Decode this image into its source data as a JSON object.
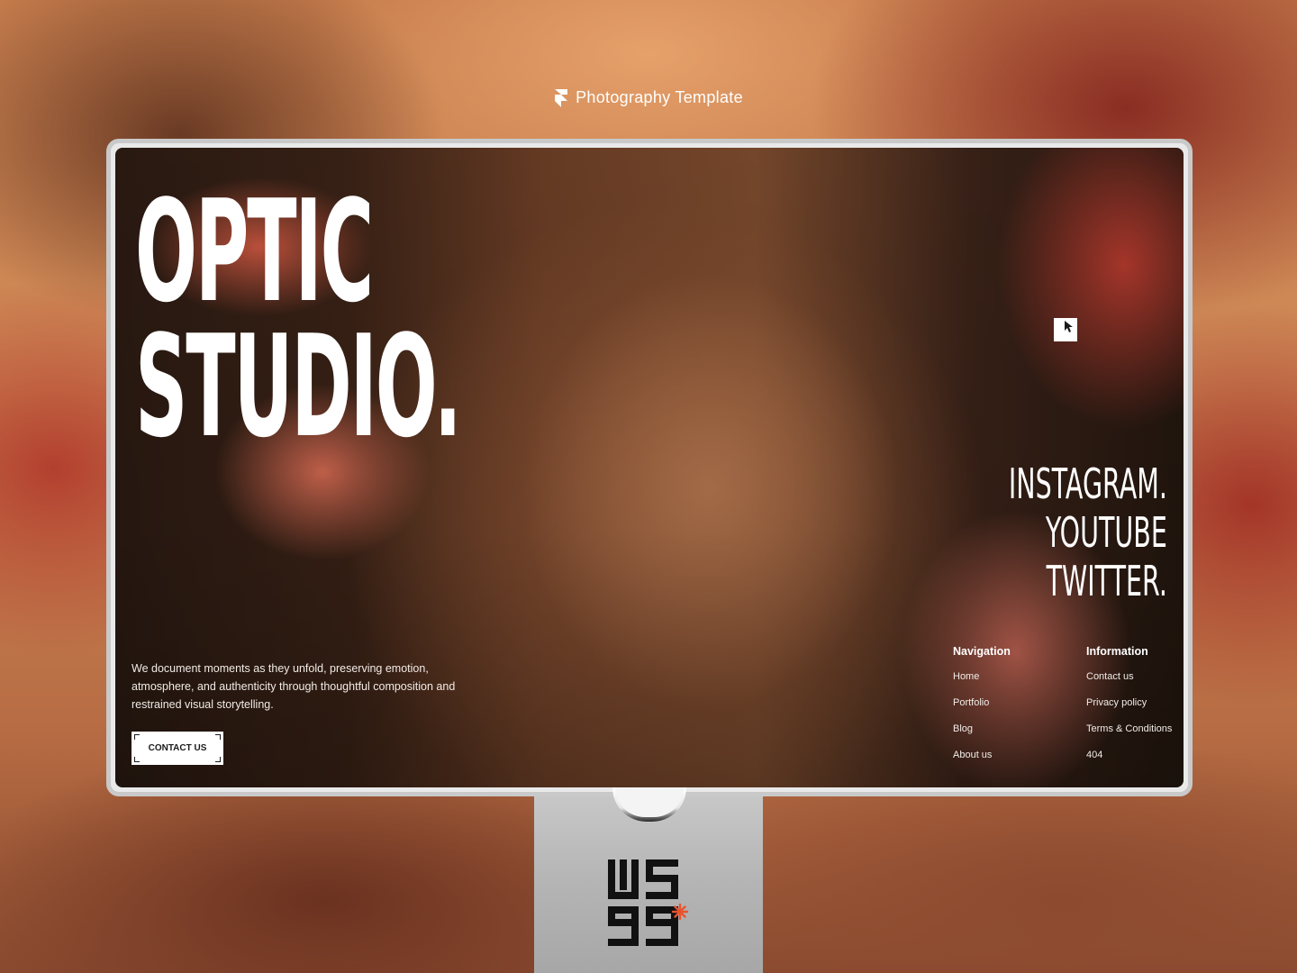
{
  "window": {
    "title": "Photography Template",
    "logo_icon": "framer-logo-icon"
  },
  "hero": {
    "headline_line1": "OPTIC",
    "headline_line2": "STUDIO.",
    "tagline": "We document moments as they unfold, preserving emotion, atmosphere, and authenticity through thoughtful composition and restrained visual storytelling.",
    "cta_label": "CONTACT US"
  },
  "social": {
    "links": [
      "INSTAGRAM.",
      "YOUTUBE",
      "TWITTER."
    ]
  },
  "footer": {
    "navigation": {
      "heading": "Navigation",
      "items": [
        "Home",
        "Portfolio",
        "Blog",
        "About us"
      ]
    },
    "information": {
      "heading": "Information",
      "items": [
        "Contact us",
        "Privacy policy",
        "Terms & Conditions",
        "404"
      ]
    }
  },
  "stand": {
    "brand_mark_icon": "ws-monogram-logo-icon",
    "accent_color": "#e8532e"
  },
  "colors": {
    "text_primary": "#ffffff",
    "button_bg": "#ffffff",
    "button_text": "#1b1b1b",
    "frame": "#c9c9c9",
    "stand": "#b4b4b4"
  }
}
